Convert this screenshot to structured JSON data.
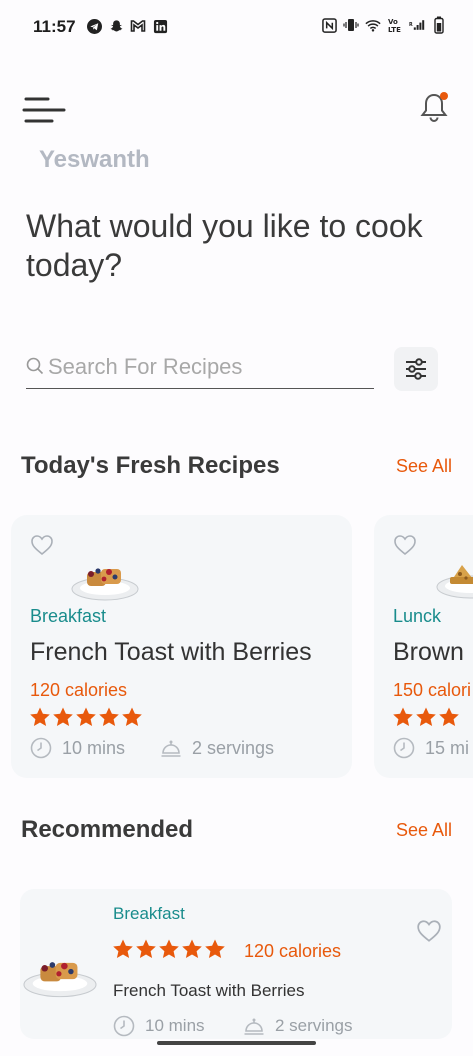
{
  "status_bar": {
    "time": "11:57",
    "left_icons": [
      "telegram-icon",
      "snapchat-icon",
      "gmail-icon",
      "linkedin-icon"
    ],
    "right_icons": [
      "nfc-icon",
      "vibrate-icon",
      "wifi-icon",
      "volte-icon",
      "signal-icon",
      "battery-icon"
    ]
  },
  "header": {
    "menu_icon": "hamburger-menu-icon",
    "notification_icon": "bell-icon",
    "notification_dot_color": "#e8590c",
    "username": "Yeswanth",
    "headline": "What would you like to cook today?"
  },
  "search": {
    "placeholder": "Search For Recipes",
    "value": "",
    "filter_icon": "sliders-icon"
  },
  "fresh": {
    "title": "Today's Fresh Recipes",
    "see_all": "See All",
    "cards": [
      {
        "category": "Breakfast",
        "title": "French Toast with Berries",
        "calories": "120 calories",
        "rating": 5,
        "time": "10 mins",
        "servings": "2 servings"
      },
      {
        "category": "Lunck",
        "title": "Brown",
        "calories": "150 calori",
        "rating": 3,
        "time": "15 mi",
        "servings": ""
      }
    ]
  },
  "recommended": {
    "title": "Recommended",
    "see_all": "See All",
    "items": [
      {
        "category": "Breakfast",
        "calories": "120 calories",
        "rating": 5,
        "title": "French Toast with Berries",
        "time": "10 mins",
        "servings": "2 servings"
      }
    ]
  },
  "colors": {
    "accent": "#e8590c",
    "category": "#198c8c",
    "card_bg": "#f5f7f9"
  }
}
